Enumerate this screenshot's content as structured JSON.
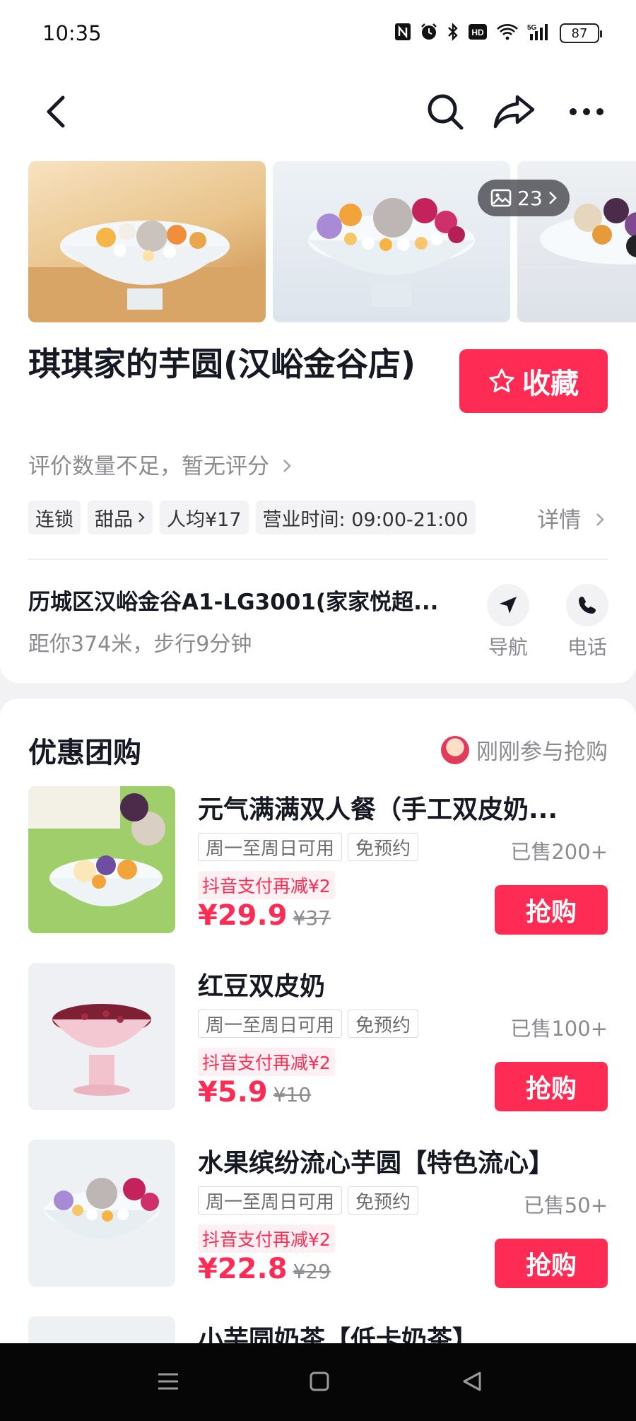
{
  "status_bar": {
    "time": "10:35",
    "icons": [
      "nfc-icon",
      "alarm-icon",
      "bluetooth-icon",
      "hd-icon",
      "wifi-icon",
      "signal-5g-icon"
    ],
    "hd_label": "HD",
    "network_label": "5G",
    "battery": "87"
  },
  "nav": {
    "back_icon": "chevron-left-icon",
    "search_icon": "search-icon",
    "share_icon": "share-icon",
    "more_icon": "more-icon"
  },
  "gallery": {
    "photo_count": "23"
  },
  "shop": {
    "name": "琪琪家的芋圆(汉峪金谷店)",
    "favorite_label": "收藏",
    "rating_text": "评价数量不足，暂无评分",
    "tags": [
      "连锁",
      "甜品",
      "人均¥17",
      "营业时间: 09:00-21:00"
    ],
    "details_label": "详情",
    "address": "历城区汉峪金谷A1-LG3001(家家悦超...",
    "distance": "距你374米，步行9分钟",
    "navigate_label": "导航",
    "phone_label": "电话"
  },
  "deals": {
    "title": "优惠团购",
    "recent_activity": "刚刚参与抢购",
    "items": [
      {
        "name": "元气满满双人餐（手工双皮奶...",
        "tags": [
          "周一至周日可用",
          "免预约"
        ],
        "sold": "已售200+",
        "promo": "抖音支付再减¥2",
        "price": "¥29.9",
        "original_price": "¥37",
        "buy_label": "抢购"
      },
      {
        "name": "红豆双皮奶",
        "tags": [
          "周一至周日可用",
          "免预约"
        ],
        "sold": "已售100+",
        "promo": "抖音支付再减¥2",
        "price": "¥5.9",
        "original_price": "¥10",
        "buy_label": "抢购"
      },
      {
        "name": "水果缤纷流心芋圆【特色流心】",
        "tags": [
          "周一至周日可用",
          "免预约"
        ],
        "sold": "已售50+",
        "promo": "抖音支付再减¥2",
        "price": "¥22.8",
        "original_price": "¥29",
        "buy_label": "抢购"
      },
      {
        "name": "小芋圆奶茶【低卡奶茶】"
      }
    ]
  },
  "system_nav": {
    "icons": [
      "menu-icon",
      "home-icon",
      "back-triangle-icon"
    ]
  },
  "colors": {
    "accent": "#fe2c55",
    "text_primary": "#161823",
    "text_secondary": "#8a8b91",
    "background": "#f2f2f4"
  }
}
